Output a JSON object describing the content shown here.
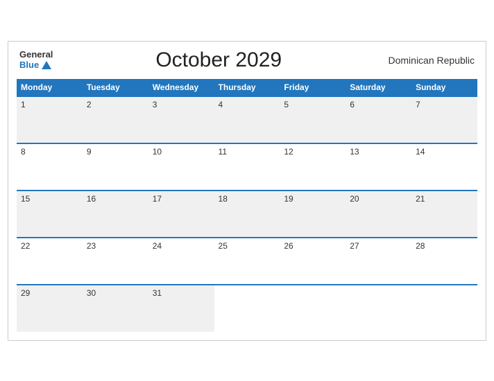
{
  "header": {
    "logo_general": "General",
    "logo_blue": "Blue",
    "title": "October 2029",
    "country": "Dominican Republic"
  },
  "days_of_week": [
    "Monday",
    "Tuesday",
    "Wednesday",
    "Thursday",
    "Friday",
    "Saturday",
    "Sunday"
  ],
  "weeks": [
    [
      "1",
      "2",
      "3",
      "4",
      "5",
      "6",
      "7"
    ],
    [
      "8",
      "9",
      "10",
      "11",
      "12",
      "13",
      "14"
    ],
    [
      "15",
      "16",
      "17",
      "18",
      "19",
      "20",
      "21"
    ],
    [
      "22",
      "23",
      "24",
      "25",
      "26",
      "27",
      "28"
    ],
    [
      "29",
      "30",
      "31",
      "",
      "",
      "",
      ""
    ]
  ],
  "colors": {
    "header_bg": "#2176bd",
    "header_text": "#ffffff",
    "odd_row_bg": "#f0f0f0",
    "even_row_bg": "#ffffff"
  }
}
